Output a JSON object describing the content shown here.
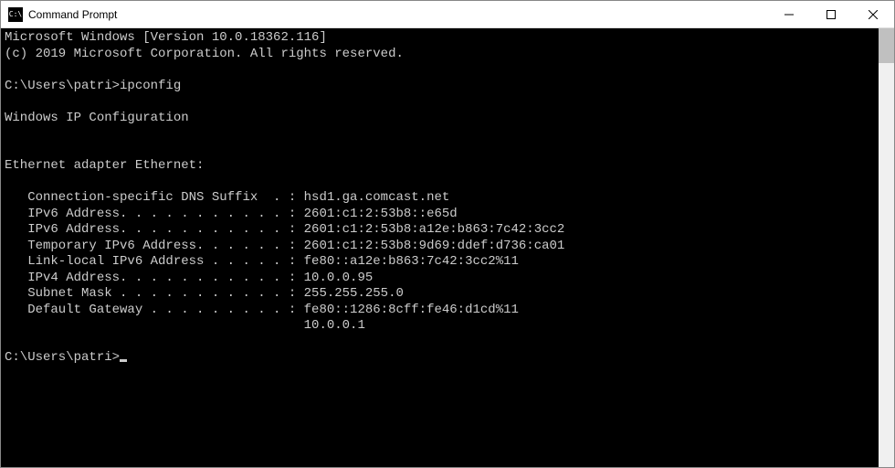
{
  "window": {
    "title": "Command Prompt"
  },
  "terminal": {
    "header1": "Microsoft Windows [Version 10.0.18362.116]",
    "header2": "(c) 2019 Microsoft Corporation. All rights reserved.",
    "prompt1": "C:\\Users\\patri>ipconfig",
    "section1": "Windows IP Configuration",
    "section2": "Ethernet adapter Ethernet:",
    "kv": {
      "dns": "   Connection-specific DNS Suffix  . : hsd1.ga.comcast.net",
      "ipv6a": "   IPv6 Address. . . . . . . . . . . : 2601:c1:2:53b8::e65d",
      "ipv6b": "   IPv6 Address. . . . . . . . . . . : 2601:c1:2:53b8:a12e:b863:7c42:3cc2",
      "tmpv6": "   Temporary IPv6 Address. . . . . . : 2601:c1:2:53b8:9d69:ddef:d736:ca01",
      "llv6": "   Link-local IPv6 Address . . . . . : fe80::a12e:b863:7c42:3cc2%11",
      "ipv4": "   IPv4 Address. . . . . . . . . . . : 10.0.0.95",
      "mask": "   Subnet Mask . . . . . . . . . . . : 255.255.255.0",
      "gw1": "   Default Gateway . . . . . . . . . : fe80::1286:8cff:fe46:d1cd%11",
      "gw2": "                                       10.0.0.1"
    },
    "prompt2": "C:\\Users\\patri>"
  }
}
